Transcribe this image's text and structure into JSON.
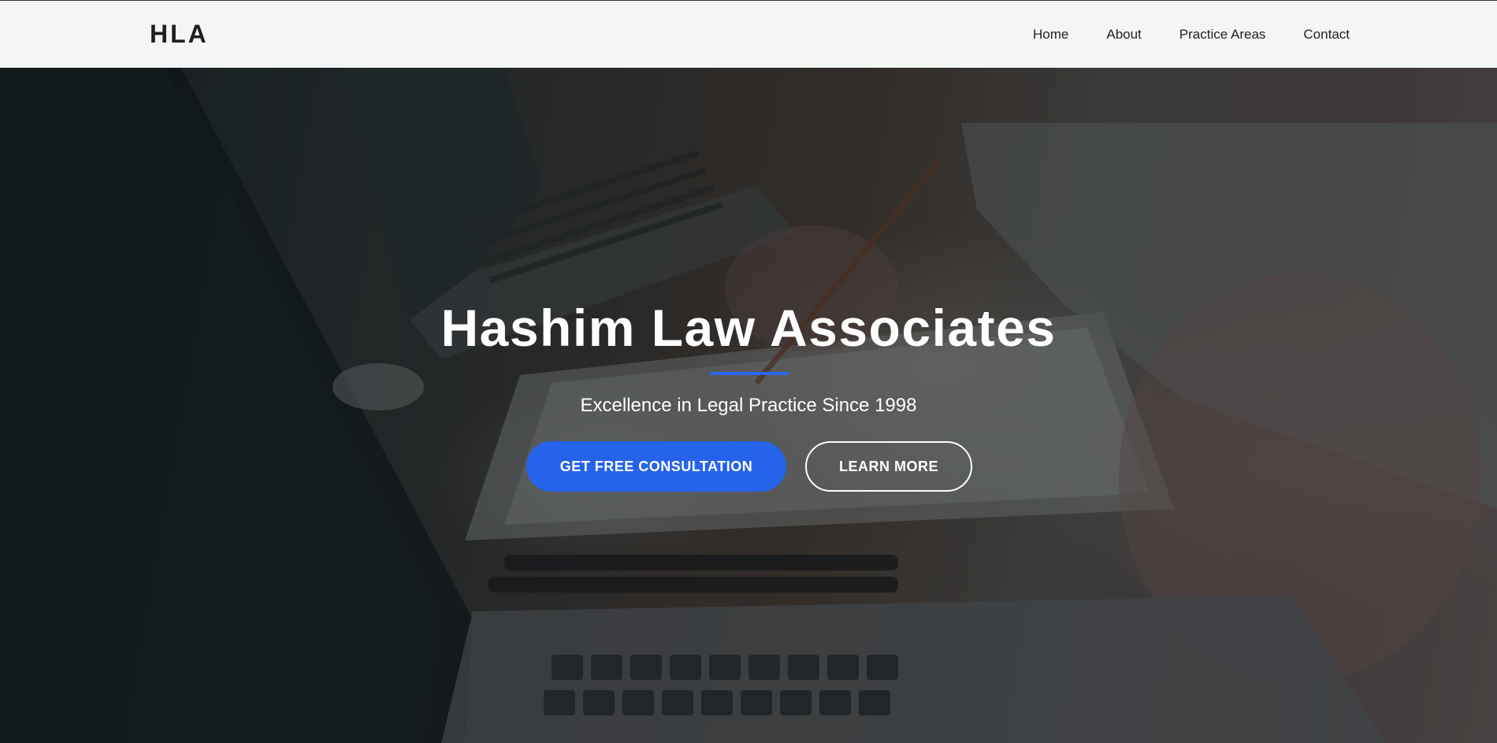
{
  "header": {
    "brand": "HLA",
    "nav": [
      {
        "label": "Home"
      },
      {
        "label": "About"
      },
      {
        "label": "Practice Areas"
      },
      {
        "label": "Contact"
      }
    ]
  },
  "hero": {
    "title": "Hashim Law Associates",
    "subtitle": "Excellence in Legal Practice Since 1998",
    "primary_button": "GET FREE CONSULTATION",
    "secondary_button": "LEARN MORE"
  },
  "colors": {
    "accent": "#2563eb",
    "rule": "#2d66ee",
    "header_bg": "#f4f5f5"
  }
}
